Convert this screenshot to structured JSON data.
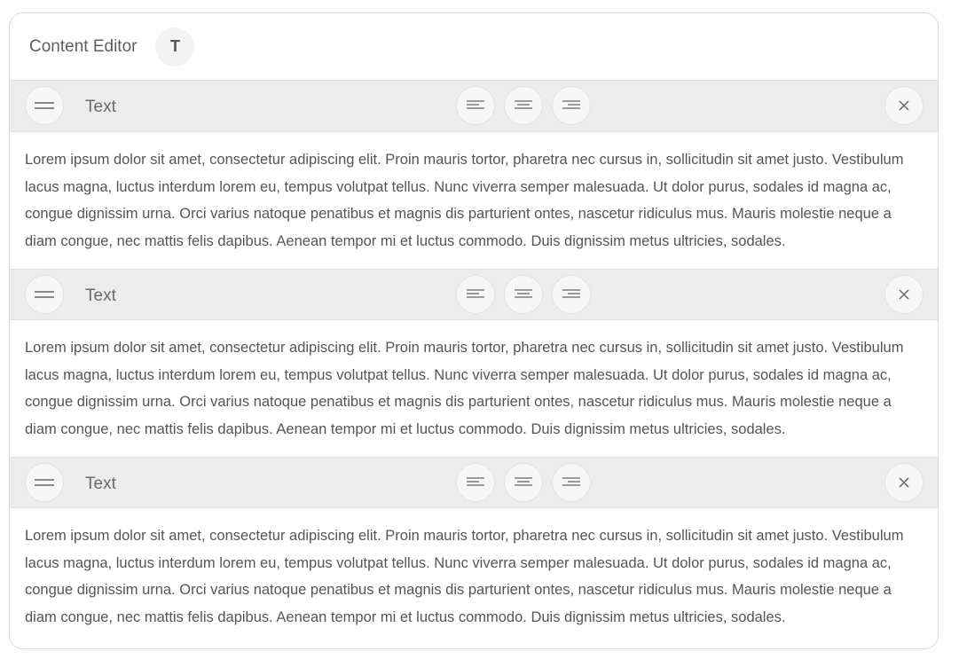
{
  "header": {
    "title": "Content Editor",
    "add_text_label": "T"
  },
  "icons": {
    "drag_handle": "menu-icon",
    "align_left": "align-left-icon",
    "align_center": "align-center-icon",
    "align_right": "align-right-icon",
    "remove": "close-icon"
  },
  "colors": {
    "toolbar_background": "#ececec",
    "text": "#555555"
  },
  "blocks": [
    {
      "type_label": "Text",
      "content": "Lorem ipsum dolor sit amet, consectetur adipiscing elit. Proin mauris tortor, pharetra nec cursus in, sollicitudin sit amet justo. Vestibulum lacus magna, luctus interdum lorem eu, tempus volutpat tellus. Nunc viverra semper malesuada. Ut dolor purus, sodales id magna ac, congue dignissim urna. Orci varius natoque penatibus et magnis dis parturient ontes, nascetur ridiculus mus. Mauris molestie neque a diam congue, nec mattis felis dapibus. Aenean tempor mi et luctus commodo. Duis dignissim metus ultricies, sodales."
    },
    {
      "type_label": "Text",
      "content": "Lorem ipsum dolor sit amet, consectetur adipiscing elit. Proin mauris tortor, pharetra nec cursus in, sollicitudin sit amet justo. Vestibulum lacus magna, luctus interdum lorem eu, tempus volutpat tellus. Nunc viverra semper malesuada. Ut dolor purus, sodales id magna ac, congue dignissim urna. Orci varius natoque penatibus et magnis dis parturient ontes, nascetur ridiculus mus. Mauris molestie neque a diam congue, nec mattis felis dapibus. Aenean tempor mi et luctus commodo. Duis dignissim metus ultricies, sodales."
    },
    {
      "type_label": "Text",
      "content": "Lorem ipsum dolor sit amet, consectetur adipiscing elit. Proin mauris tortor, pharetra nec cursus in, sollicitudin sit amet justo. Vestibulum lacus magna, luctus interdum lorem eu, tempus volutpat tellus. Nunc viverra semper malesuada. Ut dolor purus, sodales id magna ac, congue dignissim urna. Orci varius natoque penatibus et magnis dis parturient ontes, nascetur ridiculus mus. Mauris molestie neque a diam congue, nec mattis felis dapibus. Aenean tempor mi et luctus commodo. Duis dignissim metus ultricies, sodales."
    }
  ]
}
